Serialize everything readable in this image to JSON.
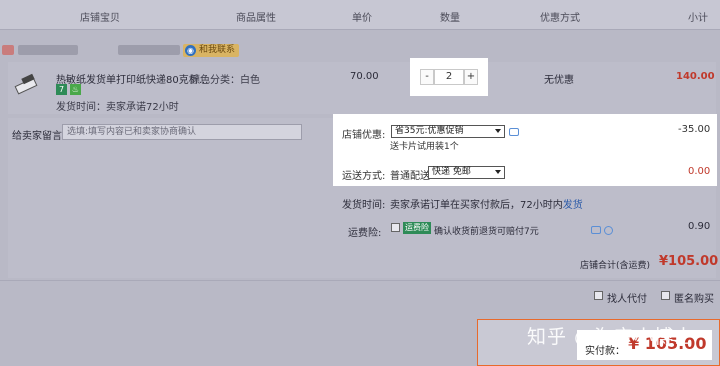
{
  "header": {
    "col_item": "店铺宝贝",
    "col_attr": "商品属性",
    "col_price": "单价",
    "col_qty": "数量",
    "col_promo": "优惠方式",
    "col_subtotal": "小计"
  },
  "shop": {
    "contact_label": "和我联系",
    "contact_icon": "wangwang-icon"
  },
  "item": {
    "title": "热敏纸发货单打印纸快递80克析...",
    "attr": "颜色分类：白色",
    "tag1": "7",
    "tag2": "♨",
    "ship_time": "发货时间：卖家承诺72小时",
    "price": "70.00",
    "qty": "2",
    "qty_minus": "-",
    "qty_plus": "+",
    "promo": "无优惠",
    "subtotal": "140.00"
  },
  "message": {
    "label": "给卖家留言：",
    "placeholder": "选填:填写内容已和卖家协商确认"
  },
  "coupon": {
    "label": "店铺优惠:",
    "selected": "省35元:优惠促销",
    "sub": "送卡片试用装1个",
    "amount": "-35.00"
  },
  "shipping": {
    "label": "运送方式:",
    "type": "普通配送",
    "selected": "快递 免邮",
    "fee": "0.00"
  },
  "delivery": {
    "label": "发货时间:",
    "text": "卖家承诺订单在买家付款后，72小时内",
    "link": "发货"
  },
  "insurance": {
    "label": "运费险:",
    "tag": "运费险",
    "text": "确认收货前退货可赔付7元",
    "fee": "0.90"
  },
  "total": {
    "label": "店铺合计(含运费)",
    "value": "¥105.00"
  },
  "options": {
    "proxy_pay": "找人代付",
    "anonymous": "匿名购买"
  },
  "payment": {
    "label": "实付款：",
    "value": "¥ 105.00",
    "watermark": "知乎 @淘宝小博士"
  }
}
